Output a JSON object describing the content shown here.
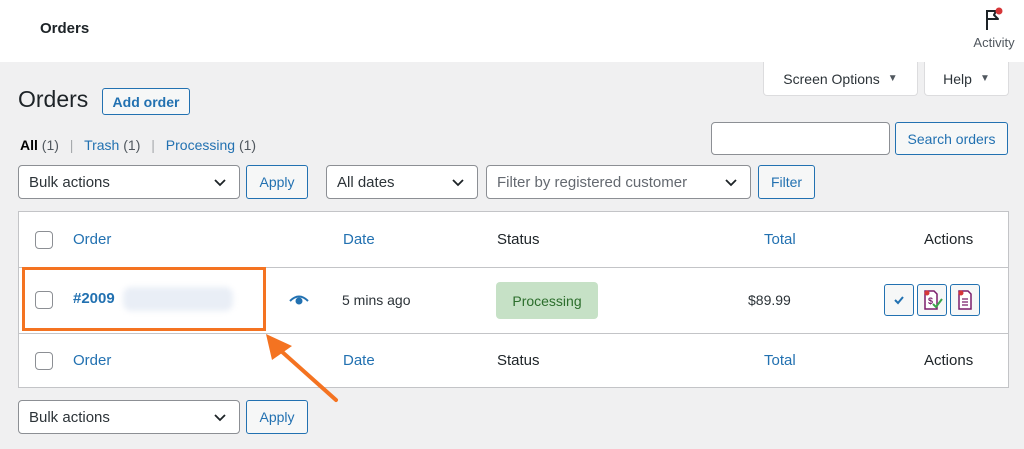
{
  "header": {
    "title": "Orders",
    "activity_label": "Activity"
  },
  "screen_options": {
    "label": "Screen Options"
  },
  "help": {
    "label": "Help"
  },
  "page": {
    "title": "Orders",
    "add_order_label": "Add order"
  },
  "filters_links": {
    "all": "All",
    "all_count": "(1)",
    "trash": "Trash",
    "trash_count": "(1)",
    "processing": "Processing",
    "processing_count": "(1)",
    "separator": "|"
  },
  "search": {
    "value": "",
    "button_label": "Search orders"
  },
  "top_actions": {
    "bulk_selected": "Bulk actions",
    "apply_label": "Apply",
    "dates_selected": "All dates",
    "customer_placeholder": "Filter by registered customer",
    "filter_label": "Filter"
  },
  "table": {
    "columns": {
      "order": "Order",
      "date": "Date",
      "status": "Status",
      "total": "Total",
      "actions": "Actions"
    },
    "rows": [
      {
        "order_number": "#2009",
        "date": "5 mins ago",
        "status": "Processing",
        "total": "$89.99"
      }
    ]
  },
  "bottom_actions": {
    "bulk_selected": "Bulk actions",
    "apply_label": "Apply"
  },
  "colors": {
    "accent": "#2271b1",
    "highlight": "#f47321",
    "status_processing_bg": "#c6e1c6",
    "status_processing_text": "#2c6e2c",
    "notification_dot": "#d63638"
  },
  "icons": {
    "activity": "flag-icon",
    "preview": "eye-icon",
    "complete": "checkmark-icon",
    "invoice": "invoice-check-icon",
    "packing_slip": "document-icon",
    "dropdown": "chevron-down-icon"
  }
}
